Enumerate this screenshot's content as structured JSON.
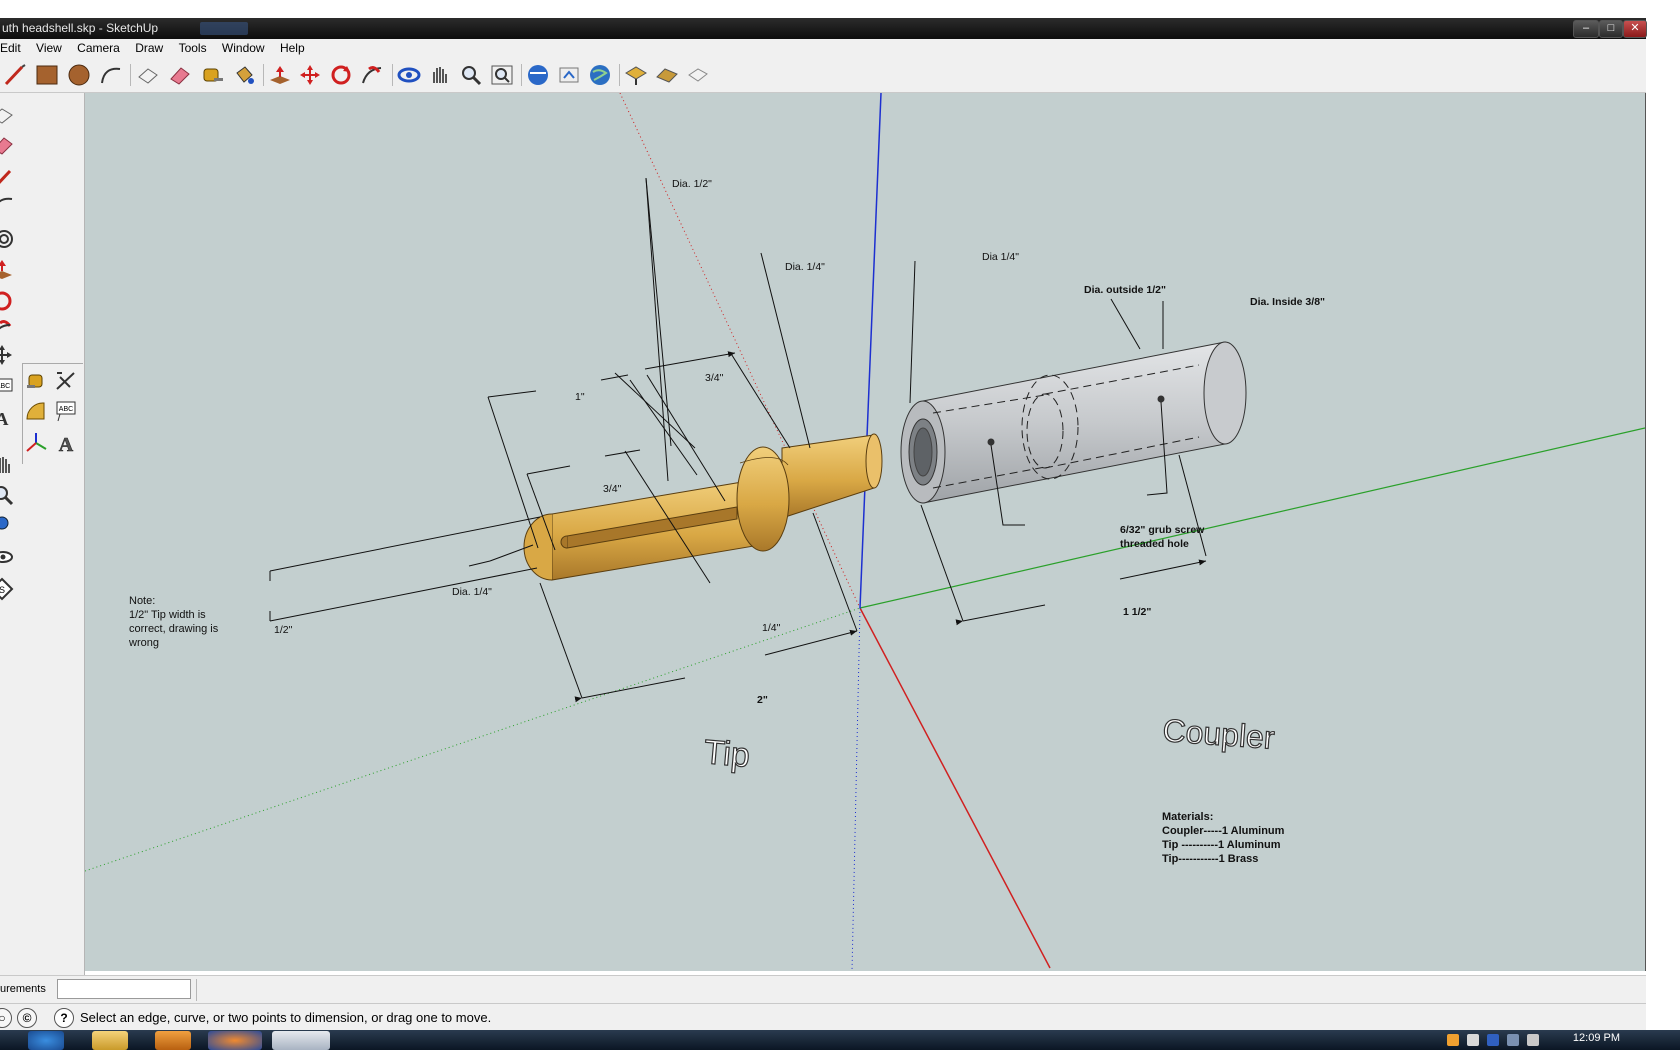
{
  "window": {
    "title": "uth headshell.skp - SketchUp",
    "controls": {
      "minimize": "–",
      "maximize": "□",
      "close": "✕"
    }
  },
  "menu": [
    "Edit",
    "View",
    "Camera",
    "Draw",
    "Tools",
    "Window",
    "Help"
  ],
  "toolbar_icons": [
    "line-tool-icon",
    "rectangle-tool-icon",
    "circle-tool-icon",
    "arc-tool-icon",
    "make-component-icon",
    "eraser-icon",
    "tape-measure-icon",
    "paint-bucket-icon",
    "push-pull-icon",
    "move-icon",
    "rotate-icon",
    "follow-me-icon",
    "orbit-icon",
    "pan-icon",
    "zoom-icon",
    "zoom-extents-icon",
    "get-models-icon",
    "share-model-icon",
    "google-earth-icon",
    "add-location-icon",
    "toggle-terrain-icon",
    "photo-textures-icon"
  ],
  "drawing": {
    "note": [
      "Note:",
      "1/2\" Tip width is",
      "correct, drawing is",
      "wrong"
    ],
    "dimensions": {
      "tip_dia_half": "Dia.  1/2\"",
      "tip_dia_quarter_top": "Dia. 1/4\"",
      "tip_one_inch": "1\"",
      "tip_three_quarter_top": "3/4\"",
      "tip_three_quarter": "3/4\"",
      "tip_dia_quarter_left": "Dia. 1/4\"",
      "tip_half_side": "1/2\"",
      "tip_quarter": "1/4\"",
      "tip_two_inch": "2\"",
      "coupler_dia_quarter": "Dia 1/4\"",
      "coupler_dia_outside": "Dia. outside 1/2\"",
      "coupler_dia_inside": "Dia. Inside 3/8\"",
      "coupler_length": "1  1/2\"",
      "grub_screw_line1": "6/32\" grub screw",
      "grub_screw_line2": "threaded hole"
    },
    "labels": {
      "tip": "Tip",
      "coupler": "Coupler"
    },
    "materials": [
      "Materials:",
      "Coupler-----1 Aluminum",
      "Tip ----------1 Aluminum",
      "Tip-----------1 Brass"
    ],
    "colors": {
      "background": "#c3cfcf",
      "brass": "#e0b45a",
      "aluminum": "#c7cacd",
      "axis_red": "#d02020",
      "axis_green": "#2aa02a",
      "axis_blue": "#1c2fd0"
    }
  },
  "measurements": {
    "label": "urements",
    "value": ""
  },
  "status": {
    "message": "Select an edge, curve, or two points to dimension, or drag one to move."
  },
  "taskbar": {
    "clock": "12:09 PM"
  }
}
